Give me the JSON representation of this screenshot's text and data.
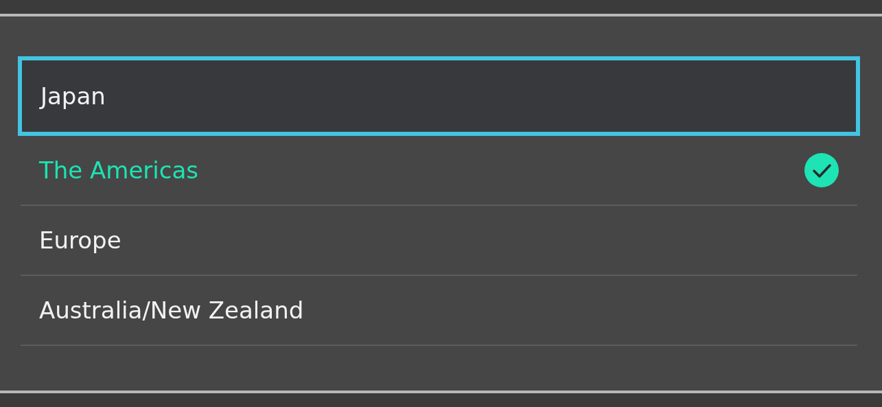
{
  "regions": [
    {
      "label": "Japan",
      "selected": false,
      "focused": true
    },
    {
      "label": "The Americas",
      "selected": true,
      "focused": false
    },
    {
      "label": "Europe",
      "selected": false,
      "focused": false
    },
    {
      "label": "Australia/New Zealand",
      "selected": false,
      "focused": false
    }
  ]
}
